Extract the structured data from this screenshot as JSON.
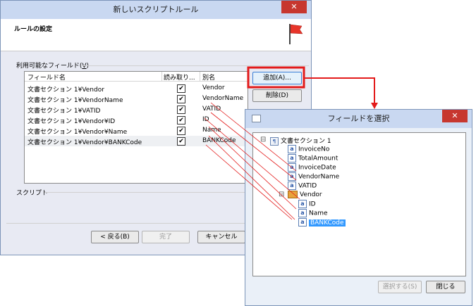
{
  "main_dialog": {
    "title": "新しいスクリプトルール",
    "close_glyph": "✕",
    "header": "ルールの設定",
    "fields_label": "利用可能なフィールド(",
    "fields_label_key": "V",
    "fields_label_end": ")",
    "columns": [
      "フィールド名",
      "読み取り...",
      "別名"
    ],
    "rows": [
      {
        "field": "文書セクション 1¥Vendor",
        "alias": "Vendor",
        "readonly": true
      },
      {
        "field": "文書セクション 1¥VendorName",
        "alias": "VendorName",
        "readonly": true
      },
      {
        "field": "文書セクション 1¥VATID",
        "alias": "VATID",
        "readonly": true
      },
      {
        "field": "文書セクション 1¥Vendor¥ID",
        "alias": "ID",
        "readonly": true
      },
      {
        "field": "文書セクション 1¥Vendor¥Name",
        "alias": "Name",
        "readonly": true
      },
      {
        "field": "文書セクション 1¥Vendor¥BANKCode",
        "alias": "BANKCode",
        "readonly": true
      }
    ],
    "add_button": "追加(A)...",
    "delete_button": "削除(D)",
    "script_label": "スクリプト",
    "back_button": "< 戻る(B)",
    "finish_button": "完了",
    "cancel_button": "キャンセル"
  },
  "select_dialog": {
    "title": "フィールドを選択",
    "close_glyph": "✕",
    "tree_root": "文書セクション 1",
    "root_children": [
      "InvoiceNo",
      "TotalAmount",
      "InvoiceDate",
      "VendorName",
      "VATID"
    ],
    "group": "Vendor",
    "group_children": [
      "ID",
      "Name",
      "BANKCode"
    ],
    "tree_expander": "⊟",
    "select_button": "選択する(S)",
    "close_button": "閉じる"
  },
  "colors": {
    "highlight": "#e31b1b",
    "selection": "#3399ff"
  }
}
